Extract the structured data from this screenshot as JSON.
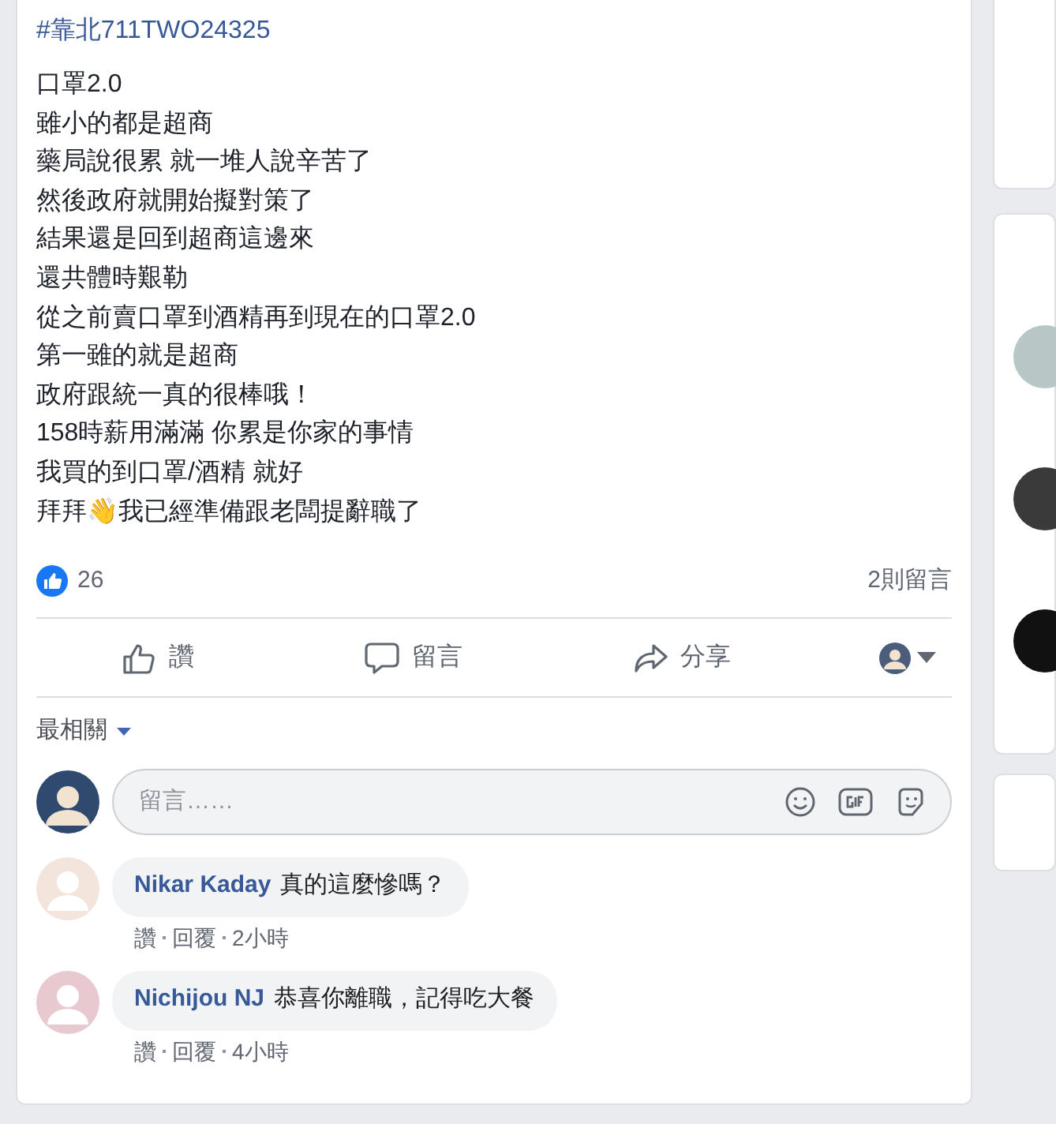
{
  "post": {
    "hashtag": "#靠北711TWO24325",
    "lines": [
      "口罩2.0",
      "雖小的都是超商",
      "藥局說很累 就一堆人說辛苦了",
      "然後政府就開始擬對策了",
      "結果還是回到超商這邊來",
      "還共體時艱勒",
      "從之前賣口罩到酒精再到現在的口罩2.0",
      "第一雖的就是超商",
      "政府跟統一真的很棒哦！",
      "158時薪用滿滿 你累是你家的事情",
      "我買的到口罩/酒精 就好",
      "拜拜👋我已經準備跟老闆提辭職了"
    ],
    "like_count": "26",
    "comment_count": "2則留言",
    "actions": [
      {
        "kind": "like",
        "label": "讚"
      },
      {
        "kind": "comment",
        "label": "留言"
      },
      {
        "kind": "share",
        "label": "分享"
      }
    ]
  },
  "comments": {
    "sort": "最相關",
    "input": {
      "placeholder": "留言……"
    },
    "items": [
      {
        "author": "Nikar Kaday",
        "text": "真的這麼慘嗎？",
        "like": "讚",
        "reply": "回覆",
        "time": "2小時"
      },
      {
        "author": "Nichijou NJ",
        "text": "恭喜你離職，記得吃大餐",
        "like": "讚",
        "reply": "回覆",
        "time": "4小時"
      }
    ]
  }
}
